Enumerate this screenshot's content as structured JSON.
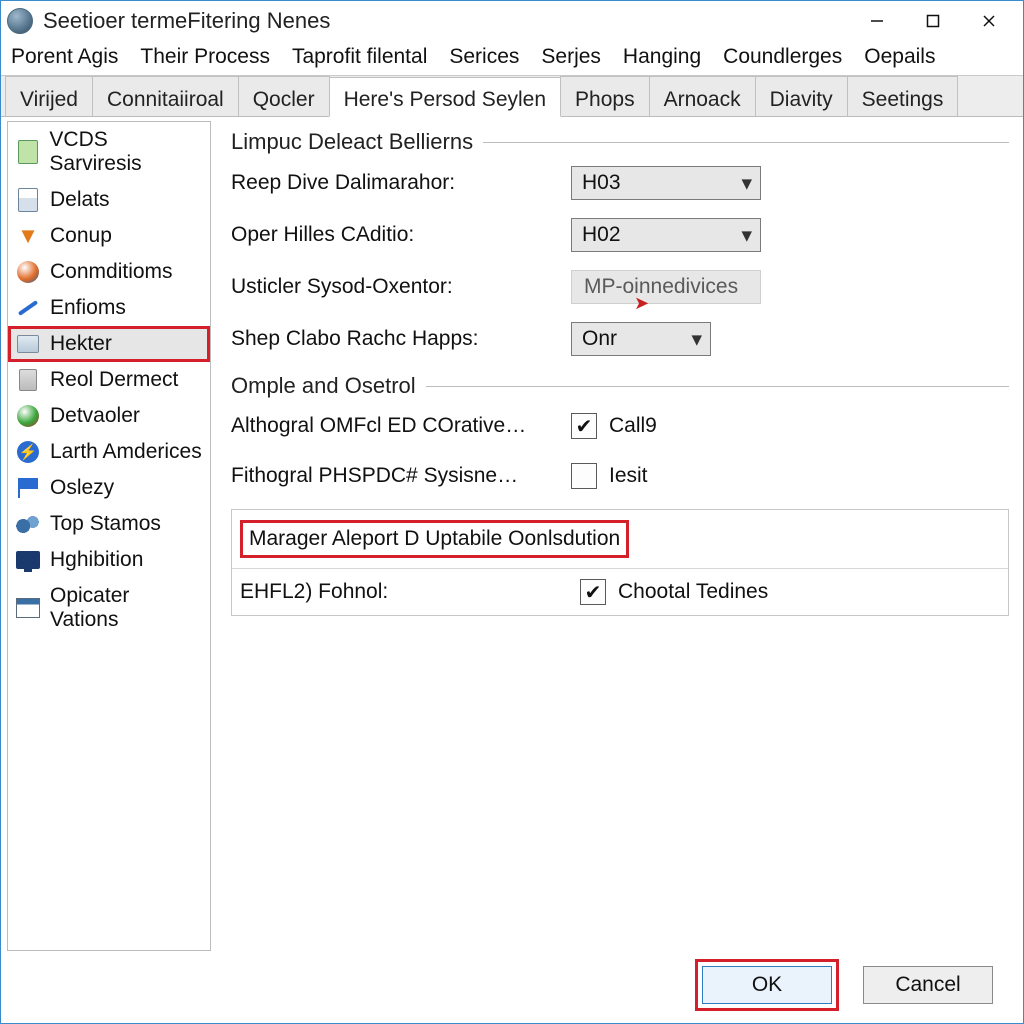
{
  "window": {
    "title": "Seetioer termeFitering Nenes"
  },
  "menu": [
    "Porent Agis",
    "Their Process",
    "Taprofit filental",
    "Serices",
    "Serjes",
    "Hanging",
    "Coundlerges",
    "Oepails"
  ],
  "tabs": [
    {
      "label": "Virijed",
      "active": false
    },
    {
      "label": "Connitaiiroal",
      "active": false
    },
    {
      "label": "Qocler",
      "active": false
    },
    {
      "label": "Here's Persod Seylen",
      "active": true
    },
    {
      "label": "Phops",
      "active": false
    },
    {
      "label": "Arnoack",
      "active": false
    },
    {
      "label": "Diavity",
      "active": false
    },
    {
      "label": "Seetings",
      "active": false
    }
  ],
  "sidebar": [
    {
      "label": "VCDS Sarviresis",
      "icon": "green-doc-icon"
    },
    {
      "label": "Delats",
      "icon": "calculator-icon"
    },
    {
      "label": "Conup",
      "icon": "orange-v-icon"
    },
    {
      "label": "Conmditioms",
      "icon": "globe-swirl-icon"
    },
    {
      "label": "Enfioms",
      "icon": "pencil-icon"
    },
    {
      "label": "Hekter",
      "icon": "card-icon",
      "selected": true
    },
    {
      "label": "Reol Dermect",
      "icon": "trash-icon"
    },
    {
      "label": "Detvaoler",
      "icon": "globe-arrow-icon"
    },
    {
      "label": "Larth Amderices",
      "icon": "bolt-icon"
    },
    {
      "label": "Oslezy",
      "icon": "flag-icon"
    },
    {
      "label": "Top Stamos",
      "icon": "gears-icon"
    },
    {
      "label": "Hghibition",
      "icon": "monitor-icon"
    },
    {
      "label": "Opicater Vations",
      "icon": "window-icon"
    }
  ],
  "group1": {
    "title": "Limpuc Deleact Bellierns",
    "row1": {
      "label": "Reep Dive Dalimarahor:",
      "value": "H03"
    },
    "row2": {
      "label": "Oper Hilles CAditio:",
      "value": "H02"
    },
    "row3": {
      "label": "Usticler Sysod-Oxentor:",
      "value": "MP-oinnedivices"
    },
    "row4": {
      "label": "Shep Clabo Rachc Happs:",
      "value": "Onr"
    }
  },
  "group2": {
    "title": "Omple and Osetrol",
    "row1": {
      "label": "Althogral OMFcl ED COrative…",
      "check_label": "Call9",
      "checked": true
    },
    "row2": {
      "label": "Fithogral PHSPDC# Sysisne…",
      "check_label": "Iesit",
      "checked": false
    },
    "row3": {
      "label": "Marager Aleport D Uptabile Oonlsdution"
    },
    "row4": {
      "label": "EHFL2) Fohnol:",
      "check_label": "Chootal Tedines",
      "checked": true
    }
  },
  "footer": {
    "ok": "OK",
    "cancel": "Cancel"
  }
}
